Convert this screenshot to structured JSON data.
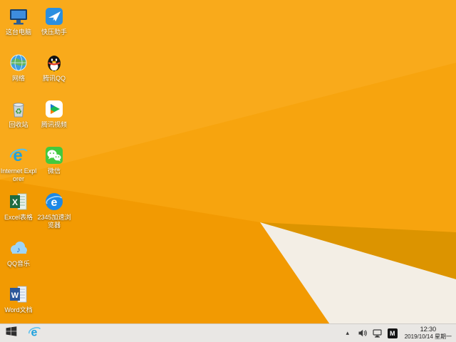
{
  "wallpaper": {
    "base_color": "#f7a40e",
    "top_shade": "#f9aa1b",
    "lower_left_shade": "#f29a02",
    "gold_wedge": "#dc9400",
    "white_wedge": "#f3eee5"
  },
  "desktop": {
    "column1": [
      {
        "label": "这台电脑",
        "icon": "this-pc-icon"
      },
      {
        "label": "网络",
        "icon": "network-icon"
      },
      {
        "label": "回收站",
        "icon": "recycle-bin-icon"
      },
      {
        "label": "Internet Explorer",
        "icon": "internet-explorer-icon"
      },
      {
        "label": "Excel表格",
        "icon": "excel-icon"
      },
      {
        "label": "QQ音乐",
        "icon": "qq-music-icon"
      },
      {
        "label": "Word文档",
        "icon": "word-icon"
      }
    ],
    "column2": [
      {
        "label": "快压助手",
        "icon": "kuaiya-icon"
      },
      {
        "label": "腾讯QQ",
        "icon": "qq-icon"
      },
      {
        "label": "腾讯视频",
        "icon": "tencent-video-icon"
      },
      {
        "label": "微信",
        "icon": "wechat-icon"
      },
      {
        "label": "2345加速浏览器",
        "icon": "browser-2345-icon"
      }
    ]
  },
  "taskbar": {
    "pinned": [
      "internet-explorer-icon"
    ],
    "tray": {
      "hidden_icons_glyph": "▴",
      "input_indicator": "M",
      "time": "12:30",
      "date": "2019/10/14 星期一"
    }
  }
}
